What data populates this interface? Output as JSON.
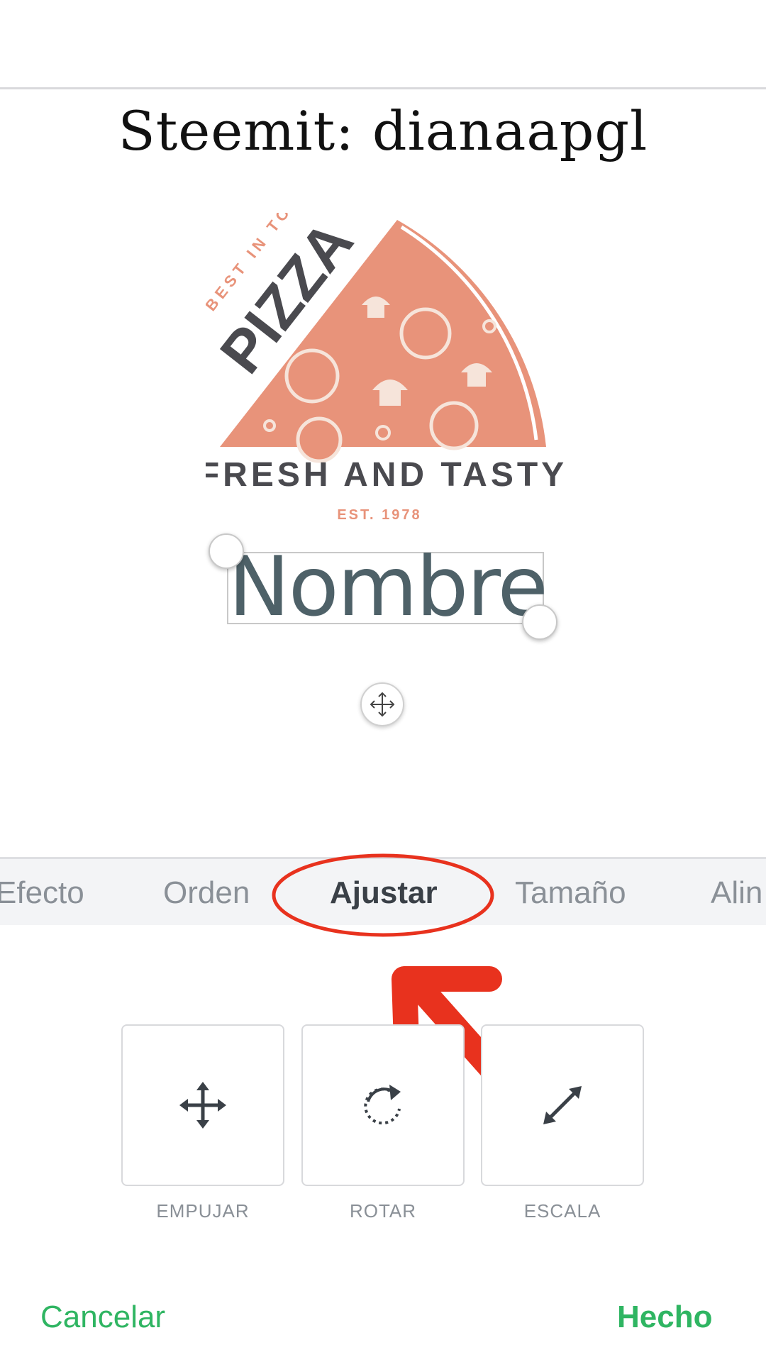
{
  "header": {
    "title": "Steemit: dianaapgl"
  },
  "logo": {
    "tagline_top": "BEST IN TOWN",
    "word": "PIZZA",
    "subtitle": "FRESH AND TASTY",
    "est": "EST.  1978",
    "icon": "pizza-slice-icon",
    "colors": {
      "salmon": "#e8937a",
      "charcoal": "#4a4a4f",
      "cream": "#f6e4da"
    }
  },
  "canvas": {
    "selected_text": "Nombre",
    "text_color": "#4e6168"
  },
  "tabs": [
    {
      "label": "Efecto",
      "active": false
    },
    {
      "label": "Orden",
      "active": false
    },
    {
      "label": "Ajustar",
      "active": true
    },
    {
      "label": "Tamaño",
      "active": false
    },
    {
      "label": "Alin",
      "active": false
    }
  ],
  "tools": [
    {
      "label": "EMPUJAR",
      "icon": "move-arrows-icon"
    },
    {
      "label": "ROTAR",
      "icon": "rotate-icon"
    },
    {
      "label": "ESCALA",
      "icon": "scale-diagonal-icon"
    }
  ],
  "footer": {
    "cancel_label": "Cancelar",
    "done_label": "Hecho"
  },
  "colors": {
    "accent": "#2fb562",
    "annotation": "#e8321e",
    "tab_bg": "#f3f4f6"
  }
}
